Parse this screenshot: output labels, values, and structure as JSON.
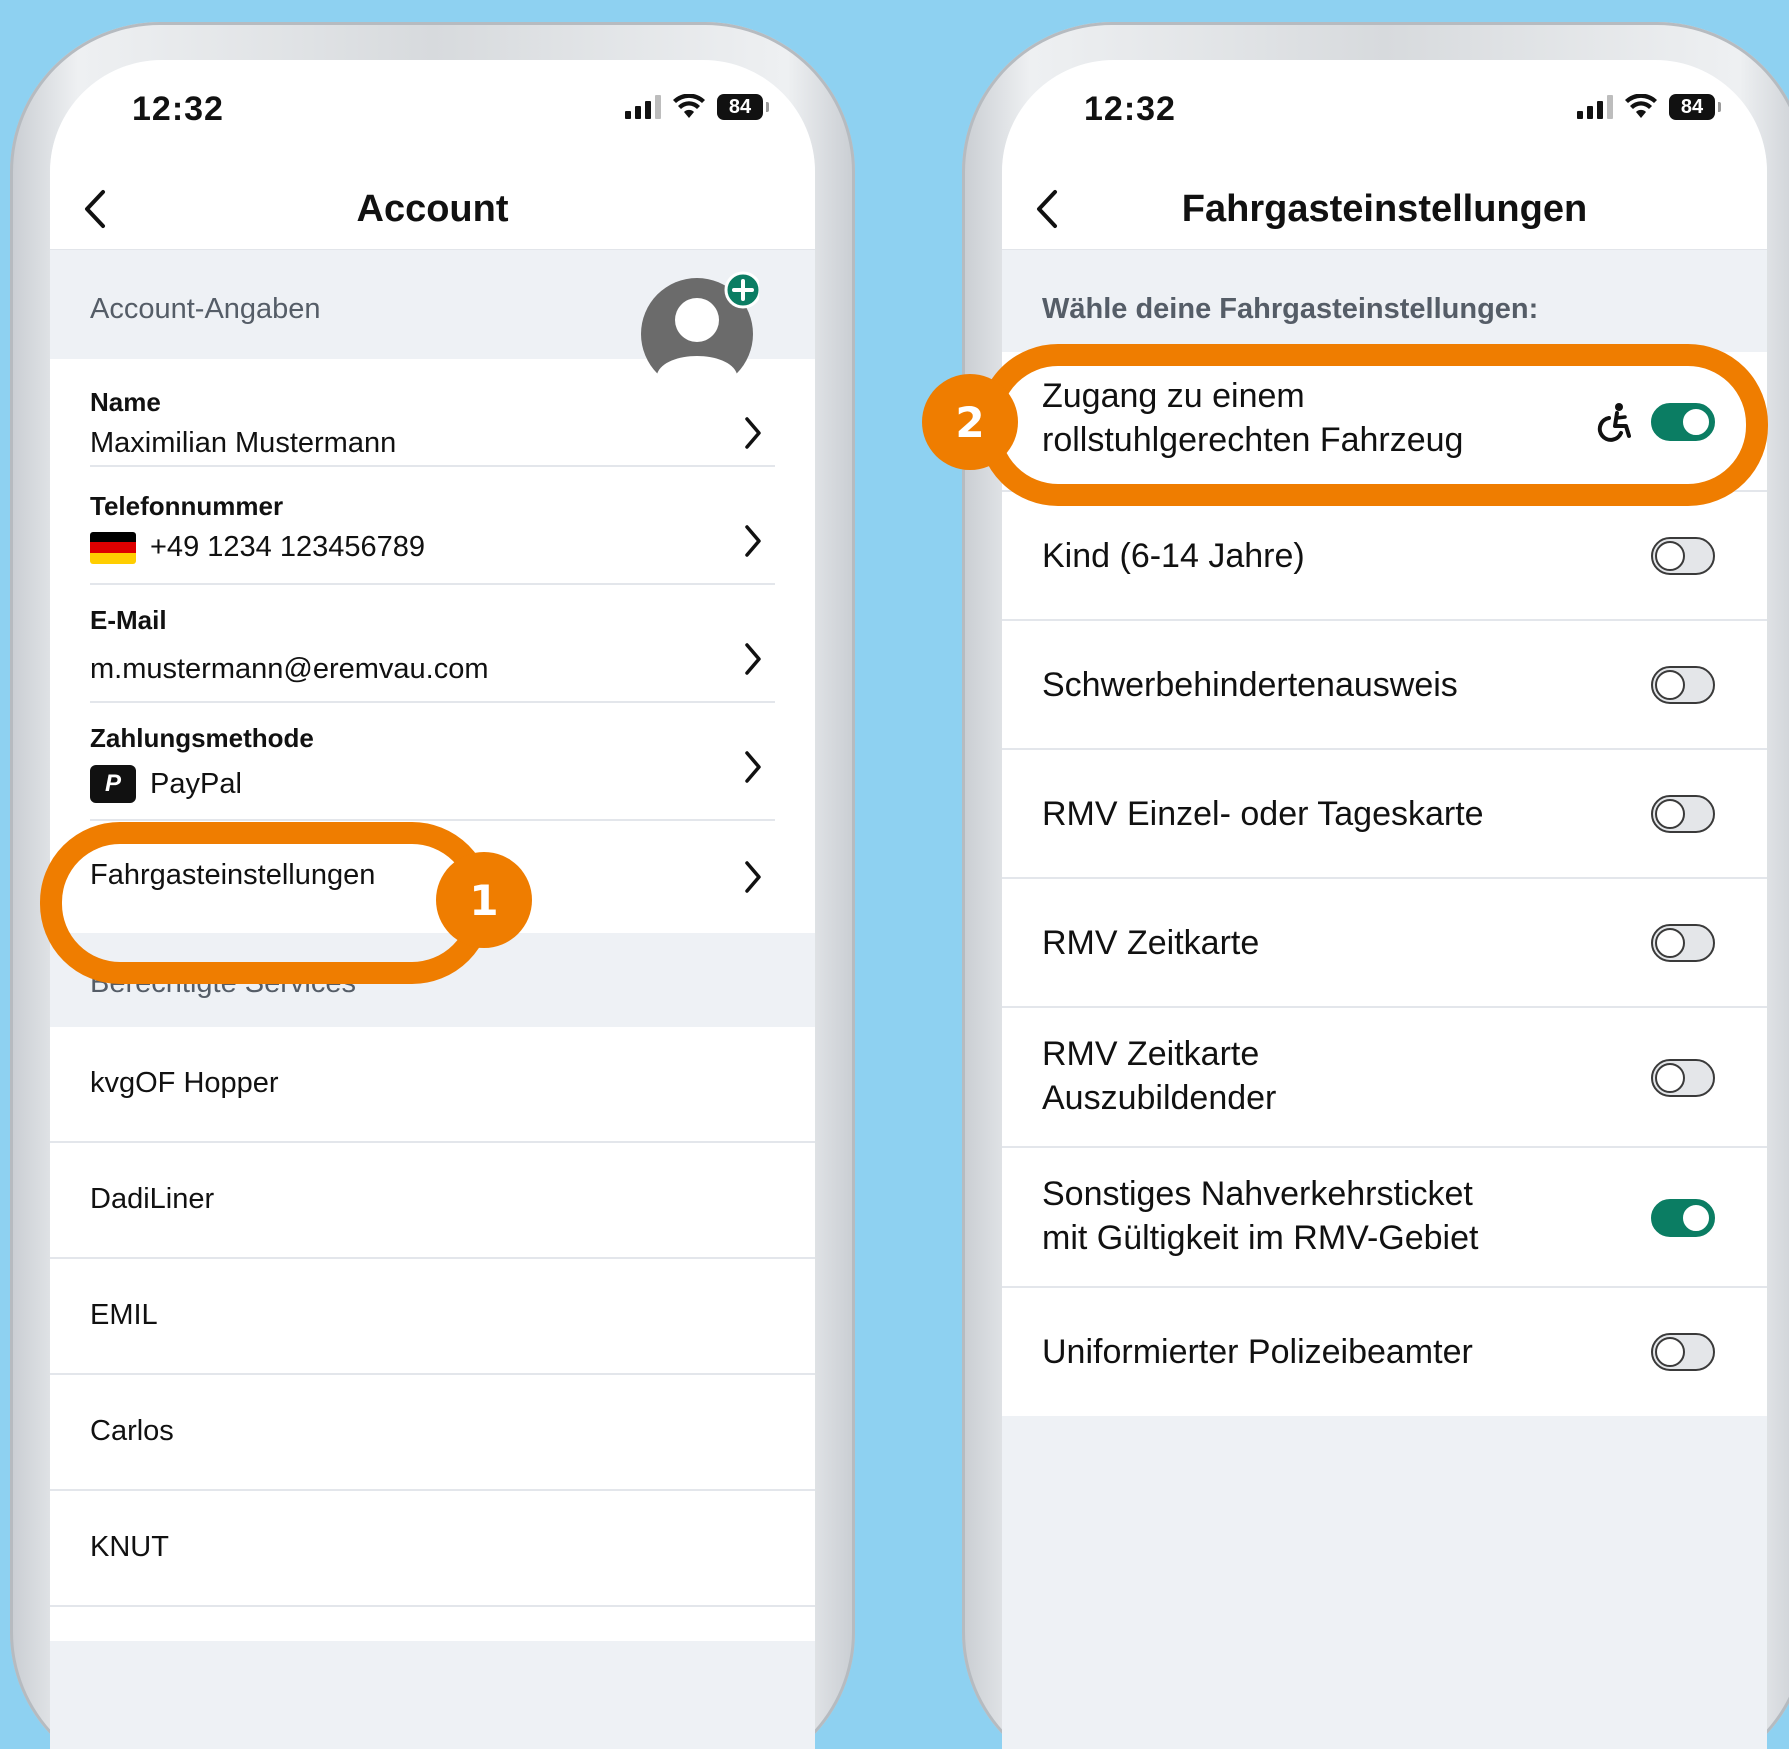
{
  "left_phone": {
    "status": {
      "time": "12:32",
      "battery": "84"
    },
    "nav": {
      "title": "Account"
    },
    "account_section_title": "Account-Angaben",
    "fields": [
      {
        "label": "Name",
        "value": "Maximilian Mustermann"
      },
      {
        "label": "Telefonnummer",
        "value": "+49 1234 123456789"
      },
      {
        "label": "E-Mail",
        "value": "m.mustermann@eremvau.com"
      },
      {
        "label": "Zahlungsmethode",
        "value": "PayPal"
      }
    ],
    "passenger_settings_label": "Fahrgasteinstellungen",
    "services_section_title": "Berechtigte Services",
    "services": [
      "kvgOF Hopper",
      "DadiLiner",
      "EMIL",
      "Carlos",
      "KNUT"
    ],
    "step_badge": "1",
    "colors": {
      "accent": "#ef7d00",
      "avatar_plus": "#0b7d63"
    }
  },
  "right_phone": {
    "status": {
      "time": "12:32",
      "battery": "84"
    },
    "nav": {
      "title": "Fahrgasteinstellungen"
    },
    "section_title": "Wähle deine Fahrgasteinstellungen:",
    "options": [
      {
        "line1": "Zugang zu einem",
        "line2": "rollstuhlgerechten Fahrzeug",
        "on": true,
        "icon": "wheelchair-icon"
      },
      {
        "line1": "Kind (6-14 Jahre)",
        "line2": "",
        "on": false
      },
      {
        "line1": "Schwerbehindertenausweis",
        "line2": "",
        "on": false
      },
      {
        "line1": "RMV Einzel- oder Tageskarte",
        "line2": "",
        "on": false
      },
      {
        "line1": "RMV Zeitkarte",
        "line2": "",
        "on": false
      },
      {
        "line1": "RMV Zeitkarte",
        "line2": "Auszubildender",
        "on": false
      },
      {
        "line1": "Sonstiges Nahverkehrsticket",
        "line2": "mit Gültigkeit im RMV-Gebiet",
        "on": true
      },
      {
        "line1": "Uniformierter Polizeibeamter",
        "line2": "",
        "on": false
      }
    ],
    "step_badge": "2",
    "colors": {
      "toggle_on": "#0b7d63",
      "accent": "#ef7d00"
    }
  }
}
